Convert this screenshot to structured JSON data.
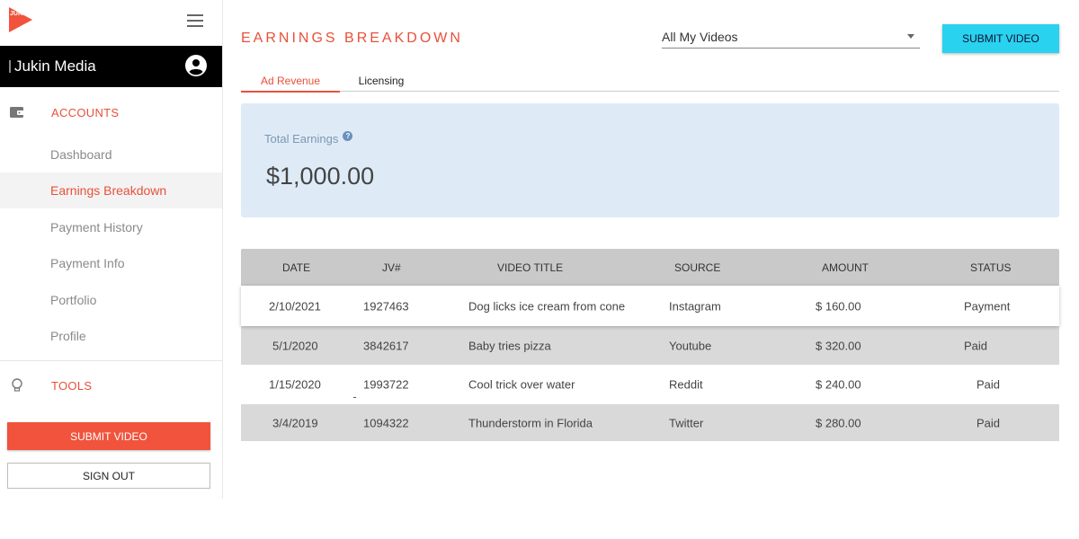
{
  "sidebar": {
    "brand": "JUKIN MEDIA",
    "user_name": "Jukin Media",
    "sections": {
      "accounts": "ACCOUNTS",
      "tools": "TOOLS"
    },
    "items": [
      {
        "label": "Dashboard"
      },
      {
        "label": "Earnings Breakdown",
        "active": true
      },
      {
        "label": "Payment History"
      },
      {
        "label": "Payment Info"
      },
      {
        "label": "Portfolio"
      },
      {
        "label": "Profile"
      }
    ],
    "submit_label": "SUBMIT VIDEO",
    "signout_label": "SIGN OUT"
  },
  "header": {
    "title": "EARNINGS BREAKDOWN",
    "video_filter": "All My Videos",
    "submit_label": "SUBMIT VIDEO"
  },
  "tabs": [
    {
      "label": "Ad Revenue",
      "active": true
    },
    {
      "label": "Licensing"
    }
  ],
  "earnings": {
    "label": "Total Earnings",
    "value": "$1,000.00"
  },
  "table": {
    "columns": [
      "DATE",
      "JV#",
      "VIDEO TITLE",
      "SOURCE",
      "AMOUNT",
      "STATUS"
    ],
    "rows": [
      {
        "date": "2/10/2021",
        "jv": "1927463",
        "title": "Dog licks ice cream from cone",
        "source": "Instagram",
        "amount": "$ 160.00",
        "status": "Payment"
      },
      {
        "date": "5/1/2020",
        "jv": "3842617",
        "title": "Baby tries pizza",
        "source": "Youtube",
        "amount": "$ 320.00",
        "status": "Paid"
      },
      {
        "date": "1/15/2020",
        "jv": "1993722",
        "title": "Cool trick over water",
        "source": "Reddit",
        "amount": "$ 240.00",
        "status": "Paid"
      },
      {
        "date": "3/4/2019",
        "jv": "1094322",
        "title": "Thunderstorm in Florida",
        "source": "Twitter",
        "amount": "$ 280.00",
        "status": "Paid"
      }
    ]
  },
  "colors": {
    "accent": "#e8503a",
    "submit_cyan": "#29d2ef",
    "card_bg": "#deebf7"
  }
}
